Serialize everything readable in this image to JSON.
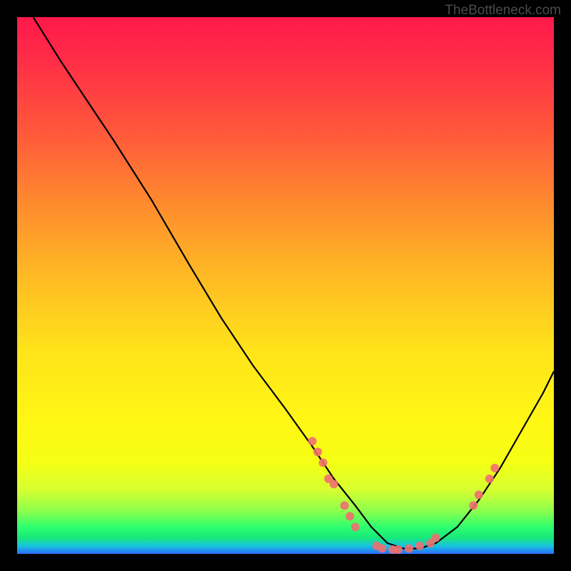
{
  "watermark": "TheBottleneck.com",
  "chart_data": {
    "type": "line",
    "title": "",
    "xlabel": "",
    "ylabel": "",
    "x_range": [
      0,
      100
    ],
    "y_range": [
      0,
      100
    ],
    "axes_visible": false,
    "background": "rainbow-vertical",
    "curve": {
      "description": "asymmetric V-shaped curve, steep descent from top-left, minimum around x≈70, rising toward right edge",
      "x": [
        3,
        8,
        12,
        18,
        25,
        32,
        38,
        44,
        50,
        55,
        59,
        63,
        66,
        69,
        72,
        75,
        78,
        82,
        86,
        90,
        94,
        98,
        100
      ],
      "y": [
        100,
        92,
        86,
        77,
        66,
        54,
        44,
        35,
        27,
        20,
        14,
        9,
        5,
        2,
        1,
        1,
        2,
        5,
        10,
        16,
        23,
        30,
        34
      ]
    },
    "markers": {
      "description": "salmon circular markers clustered along the curve near the bottom on both flanks of the minimum",
      "points": [
        {
          "x": 55,
          "y": 21
        },
        {
          "x": 56,
          "y": 19
        },
        {
          "x": 57,
          "y": 17
        },
        {
          "x": 58,
          "y": 14
        },
        {
          "x": 59,
          "y": 13
        },
        {
          "x": 61,
          "y": 9
        },
        {
          "x": 62,
          "y": 7
        },
        {
          "x": 63,
          "y": 5
        },
        {
          "x": 67,
          "y": 1.5
        },
        {
          "x": 68,
          "y": 1
        },
        {
          "x": 70,
          "y": 0.8
        },
        {
          "x": 71,
          "y": 0.8
        },
        {
          "x": 73,
          "y": 1
        },
        {
          "x": 75,
          "y": 1.5
        },
        {
          "x": 77,
          "y": 2
        },
        {
          "x": 78,
          "y": 3
        },
        {
          "x": 85,
          "y": 9
        },
        {
          "x": 86,
          "y": 11
        },
        {
          "x": 88,
          "y": 14
        },
        {
          "x": 89,
          "y": 16
        }
      ],
      "color": "#ef6f6f",
      "radius_px": 6
    }
  },
  "colors": {
    "frame_border": "#000000",
    "curve_stroke": "#000000",
    "marker_fill": "#ef6f6f",
    "watermark": "#4a4a4a"
  }
}
